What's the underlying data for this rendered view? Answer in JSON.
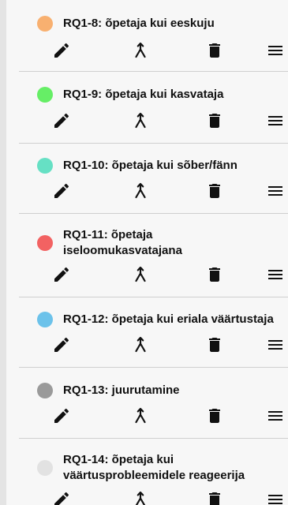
{
  "categories": [
    {
      "code_label": "RQ1-8: õpetaja kui eeskuju",
      "color": "#f8b070"
    },
    {
      "code_label": "RQ1-9: õpetaja kui kasvataja",
      "color": "#66ee66"
    },
    {
      "code_label": "RQ1-10: õpetaja kui sõber/fänn",
      "color": "#66e0c4"
    },
    {
      "code_label": "RQ1-11: õpetaja iseloomukasvatajana",
      "color": "#f26262"
    },
    {
      "code_label": "RQ1-12: õpetaja kui eriala väärtustaja",
      "color": "#6cc2ea"
    },
    {
      "code_label": "RQ1-13: juurutamine",
      "color": "#9a9a9a"
    },
    {
      "code_label": "RQ1-14: õpetaja kui väärtusprobleemidele reageerija",
      "color": "#e2e2e2"
    }
  ],
  "icons": {
    "edit": "pencil-icon",
    "merge": "merge-icon",
    "delete": "trash-icon",
    "drag": "drag-handle-icon"
  }
}
